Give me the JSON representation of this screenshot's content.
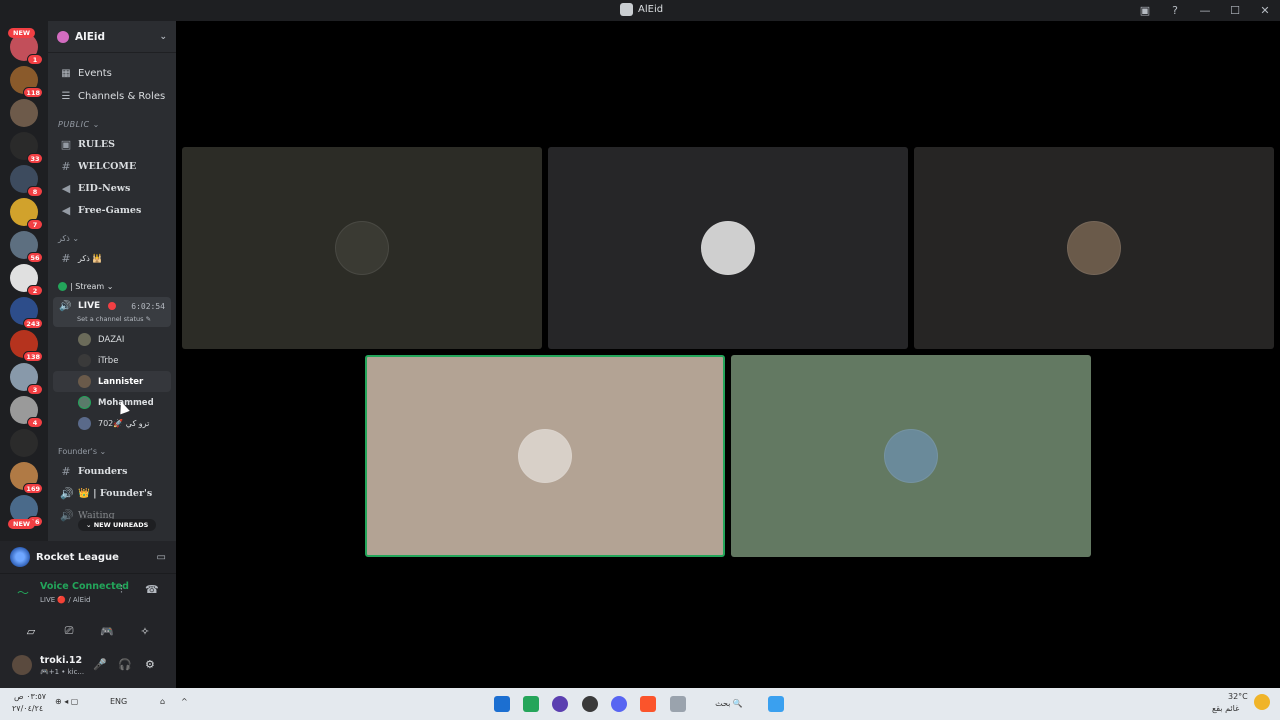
{
  "window": {
    "title": "AlEid"
  },
  "server_rail": {
    "new_label_top": "NEW",
    "new_label_bottom": "NEW",
    "servers": [
      {
        "badge": "1",
        "color": "#c24f5a"
      },
      {
        "badge": "118",
        "color": "#8a5a2b"
      },
      {
        "badge": "",
        "color": "#6d5a4a"
      },
      {
        "badge": "33",
        "color": "#2a2a2a"
      },
      {
        "badge": "8",
        "color": "#3d4b5e"
      },
      {
        "badge": "7",
        "color": "#d1a22c"
      },
      {
        "badge": "56",
        "color": "#5d6f80"
      },
      {
        "badge": "2",
        "color": "#e0e0e0"
      },
      {
        "badge": "243",
        "color": "#2d4d8a"
      },
      {
        "badge": "138",
        "color": "#b5331e"
      },
      {
        "badge": "3",
        "color": "#8899aa"
      },
      {
        "badge": "4",
        "color": "#9a9a9a"
      },
      {
        "badge": "",
        "color": "#2b2b2b"
      },
      {
        "badge": "169",
        "color": "#b07a45"
      },
      {
        "badge": "16",
        "color": "#4a6a8a"
      }
    ]
  },
  "sidebar": {
    "guild_name": "AlEid",
    "nav": [
      {
        "icon": "calendar-icon",
        "glyph": "▦",
        "label": "Events"
      },
      {
        "icon": "channels-roles-icon",
        "glyph": "☰",
        "label": "Channels & Roles"
      }
    ],
    "category_public": "PUBLIC ⌄",
    "public_channels": [
      {
        "icon": "rules-icon",
        "glyph": "▣",
        "label": "RULES"
      },
      {
        "icon": "hash-icon",
        "glyph": "#",
        "label": "WELCOME"
      },
      {
        "icon": "megaphone-icon",
        "glyph": "◀",
        "label": "EID-News"
      },
      {
        "icon": "megaphone-icon",
        "glyph": "◀",
        "label": "Free-Games"
      }
    ],
    "category_dhikr": "ذكر ⌄",
    "dhikr_channel": "ذكر 🕌",
    "category_stream": "| Stream ⌄",
    "live_channel": {
      "label": "LIVE",
      "timer": "6:02:54",
      "status": "Set a channel status ✎"
    },
    "members": [
      {
        "name": "DAZAI",
        "color": "#6b6b5a"
      },
      {
        "name": "iTrbe",
        "color": "#3a3a3a"
      },
      {
        "name": "Lannister",
        "color": "#6a5a4a",
        "active": true
      },
      {
        "name": "Mohammed",
        "color": "#5a7a6a"
      },
      {
        "name": "ترو كي 🚀702",
        "color": "#5a6a8a"
      }
    ],
    "category_founders": "Founder's ⌄",
    "founders_channels": [
      {
        "icon": "hash-icon",
        "glyph": "#",
        "label": "Founders"
      },
      {
        "icon": "speaker-icon",
        "glyph": "🔊",
        "label": "👑 | Founder's"
      },
      {
        "icon": "speaker-icon",
        "glyph": "🔊",
        "label": "Waiting"
      }
    ],
    "new_unreads": "⌄ NEW UNREADS"
  },
  "activity": {
    "name": "Rocket League"
  },
  "voice": {
    "title": "Voice Connected",
    "subtitle": "LIVE 🔴 / AlEid"
  },
  "user": {
    "name": "troki.12",
    "status": "🎮+1 • kic..."
  },
  "tiles": [
    {
      "name": "tile-user-1",
      "bg": "#2c2c26",
      "avatar": "#3a3a33"
    },
    {
      "name": "tile-user-2",
      "bg": "#262628",
      "avatar": "#cfcfcf"
    },
    {
      "name": "tile-user-3",
      "bg": "#262524",
      "avatar": "#6a5a4a"
    },
    {
      "name": "tile-user-4",
      "bg": "#b3a394",
      "avatar": "#d8d0c8",
      "speaking": true
    },
    {
      "name": "tile-user-5",
      "bg": "#637962",
      "avatar": "#6a8a9a"
    }
  ],
  "taskbar": {
    "time": "٠٣:٥٧ ص",
    "date": "٢٧/٠٤/٢٤",
    "lang": "ENG",
    "search": "بحث 🔍",
    "weather": "32°C",
    "weather_sub": "غائم بقع"
  }
}
